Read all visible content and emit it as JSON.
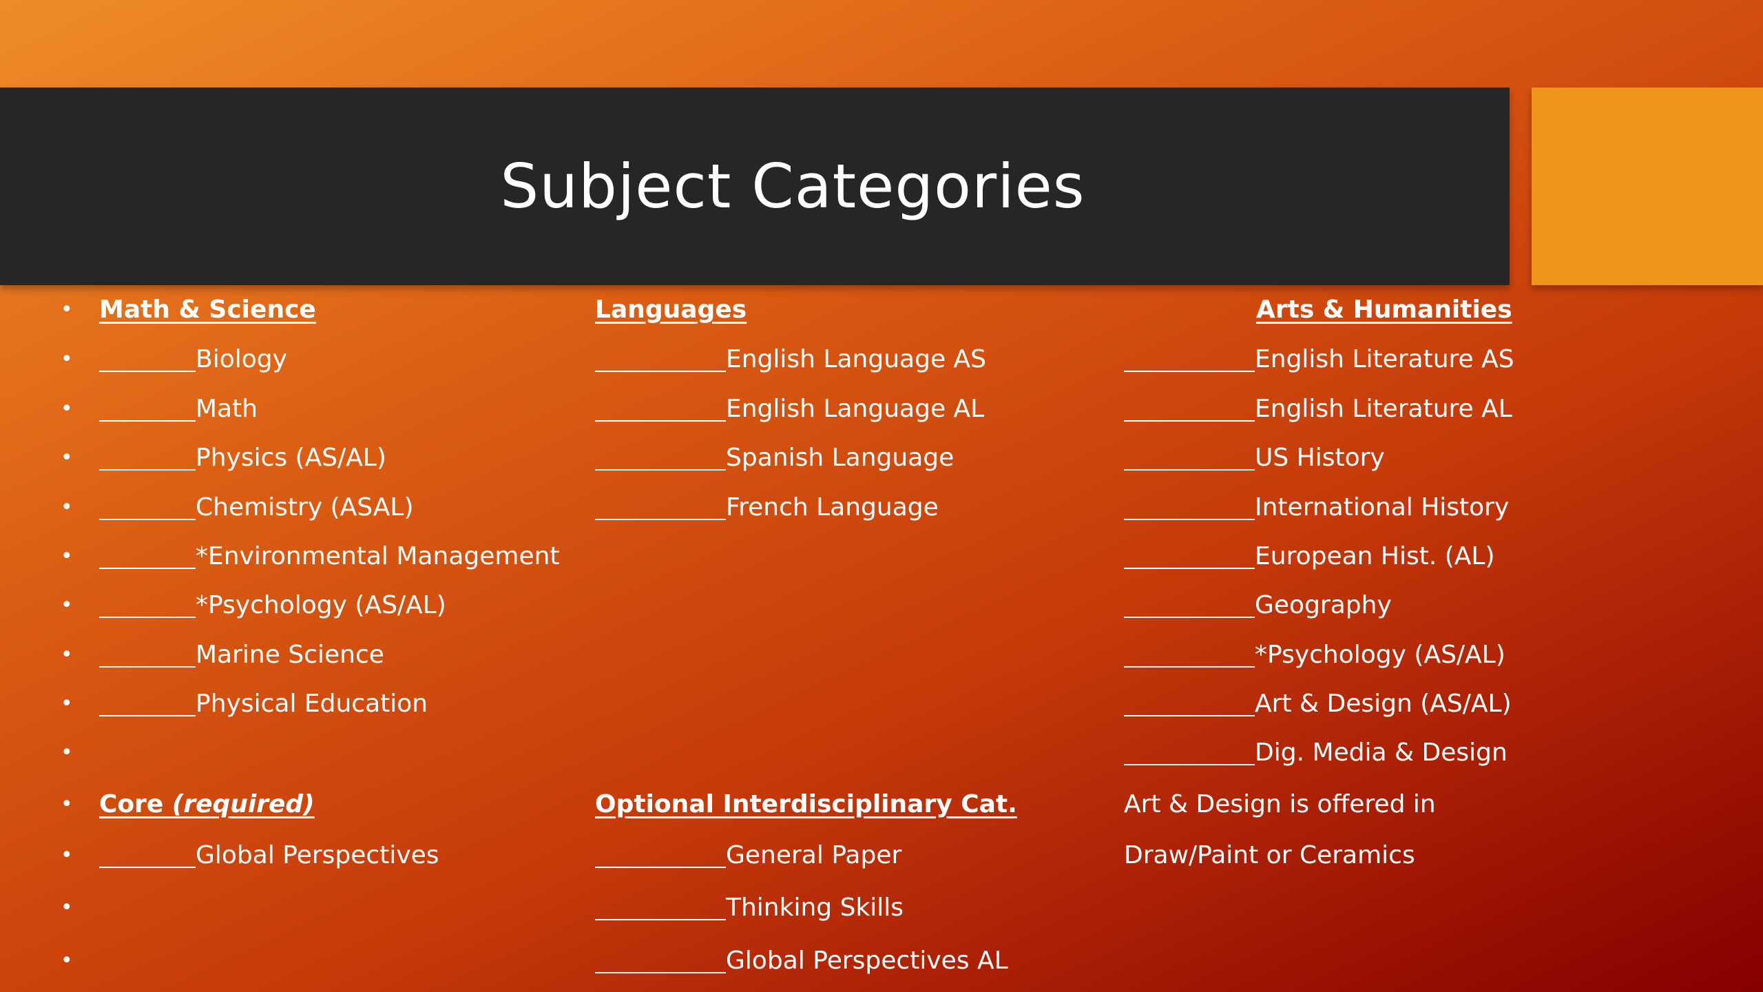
{
  "slide": {
    "title": "Subject Categories",
    "colors": {
      "title_bar": "#262626",
      "accent_square": "#ef961a",
      "text": "#ffffff"
    }
  },
  "math_science": {
    "heading": "Math & Science",
    "items": [
      "Biology",
      "Math",
      "Physics (AS/AL)",
      "Chemistry (ASAL)",
      "*Environmental Management",
      "*Psychology (AS/AL)",
      "Marine Science",
      "Physical Education"
    ]
  },
  "core": {
    "heading": "Core ",
    "heading_emphasis": "(required)",
    "items": [
      "Global Perspectives"
    ]
  },
  "languages": {
    "heading": "Languages",
    "items": [
      "English Language AS",
      "English Language AL",
      "Spanish Language",
      "French Language"
    ]
  },
  "optional": {
    "heading": "Optional Interdisciplinary Cat.",
    "items": [
      "General Paper",
      "Thinking Skills",
      "Global Perspectives AL"
    ]
  },
  "arts_humanities": {
    "heading": "Arts & Humanities",
    "items": [
      "English Literature AS",
      "English Literature AL",
      "US History",
      "International History",
      "European Hist. (AL)",
      "Geography",
      "*Psychology (AS/AL)",
      "Art & Design (AS/AL)",
      "Dig. Media & Design"
    ],
    "note_line1": "Art & Design is offered in",
    "note_line2": "Draw/Paint or Ceramics"
  },
  "bullet_char": "•"
}
